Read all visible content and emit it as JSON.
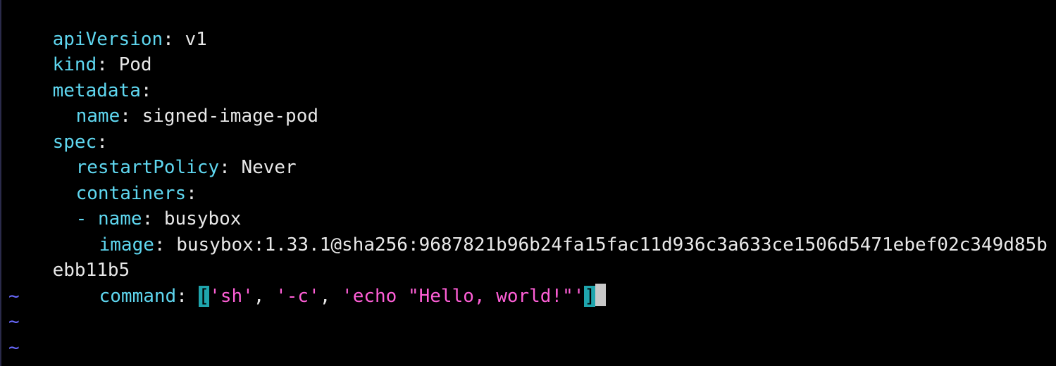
{
  "window": {
    "app": "vim",
    "file_type": "yaml"
  },
  "lines": {
    "apiVersion": {
      "key": "apiVersion",
      "sep": ": ",
      "value": "v1"
    },
    "kind": {
      "key": "kind",
      "sep": ": ",
      "value": "Pod"
    },
    "metadata": {
      "key": "metadata",
      "sep": ":"
    },
    "name": {
      "key": "name",
      "sep": ": ",
      "value": "signed-image-pod"
    },
    "spec": {
      "key": "spec",
      "sep": ":"
    },
    "restartPolicy": {
      "key": "restartPolicy",
      "sep": ": ",
      "value": "Never"
    },
    "containers": {
      "key": "containers",
      "sep": ":"
    },
    "container_name": {
      "dash": "- ",
      "key": "name",
      "sep": ": ",
      "value": "busybox"
    },
    "image": {
      "key": "image",
      "sep": ": ",
      "value": "busybox:1.33.1@sha256:9687821b96b24fa15fac11d936c3a633ce1506d5471ebef02c349d85b"
    },
    "image_wrap": {
      "value": "ebb11b5"
    },
    "command": {
      "key": "command",
      "sep": ": ",
      "open_bracket": "[",
      "arg1": "'sh'",
      "comma1": ", ",
      "arg2": "'-c'",
      "comma2": ", ",
      "arg3": "'echo \"Hello, world!\"'",
      "close_bracket": "]"
    }
  },
  "empty_line_marker": "~",
  "colors": {
    "background": "#000000",
    "key": "#5fd7f0",
    "string": "#ff5fd7",
    "text": "#e8e8e8",
    "tilde": "#6a6aff",
    "bracket_highlight": "#1fa5ad",
    "cursor": "#c8c8c8"
  }
}
